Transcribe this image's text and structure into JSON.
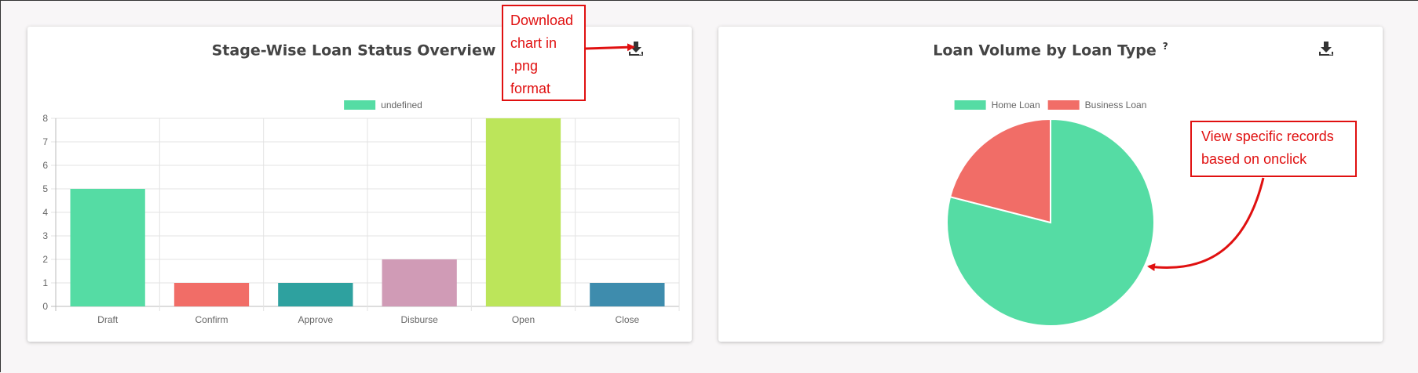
{
  "charts": {
    "left": {
      "title": "Stage-Wise Loan Status Overview",
      "help": "?"
    },
    "right": {
      "title": "Loan Volume by Loan Type",
      "help": "?"
    }
  },
  "annotations": {
    "download": [
      "Download",
      "chart in",
      ".png",
      "format"
    ],
    "view": [
      "View specific records",
      "based on onclick"
    ]
  },
  "icons": {
    "download": "download-icon"
  },
  "colors": {
    "annotation": "#e01010"
  },
  "chart_data": [
    {
      "type": "bar",
      "title": "Stage-Wise Loan Status Overview",
      "categories": [
        "Draft",
        "Confirm",
        "Approve",
        "Disburse",
        "Open",
        "Close"
      ],
      "values": [
        5,
        1,
        1,
        2,
        8,
        1
      ],
      "bar_colors": [
        "#55dca4",
        "#f16d67",
        "#2ea19f",
        "#d09bb6",
        "#bce55a",
        "#3e8cad"
      ],
      "legend": [
        {
          "label": "undefined",
          "color": "#55dca4"
        }
      ],
      "legend_position": "top",
      "ylim": [
        0,
        8
      ],
      "yticks": [
        0,
        1,
        2,
        3,
        4,
        5,
        6,
        7,
        8
      ],
      "grid": true,
      "xlabel": "",
      "ylabel": ""
    },
    {
      "type": "pie",
      "title": "Loan Volume by Loan Type",
      "labels": [
        "Home Loan",
        "Business Loan"
      ],
      "values": [
        79,
        21
      ],
      "colors": [
        "#55dca4",
        "#f16d67"
      ],
      "legend_position": "top"
    }
  ]
}
